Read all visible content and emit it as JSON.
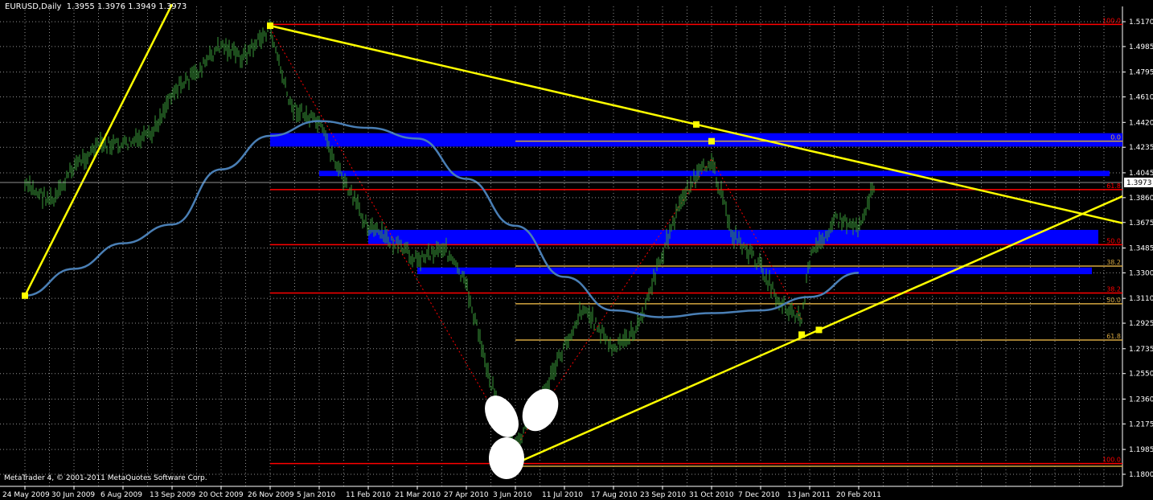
{
  "header": {
    "symbol": "EURUSD,Daily",
    "ohlc": "1.3955 1.3976 1.3949 1.3973"
  },
  "footer": {
    "copyright": "MetaTrader 4, © 2001-2011 MetaQuotes Software Corp."
  },
  "colors": {
    "background": "#000000",
    "grid": "#c0c0c0",
    "price_bars": "#3a9a3a",
    "moving_average": "#4a7fb5",
    "trendline": "#ffff00",
    "support_resistance": "#ff0000",
    "fib_gold": "#d4a640",
    "zone_blue": "#0000ff",
    "axis_text": "#ffffff",
    "current_price_bg": "#ffffff",
    "marker_fill": "#ffffff"
  },
  "chart_data": {
    "type": "candlestick",
    "title": "EURUSD,Daily",
    "ylim": [
      1.171,
      1.53
    ],
    "y_ticks": [
      "1.5170",
      "1.4985",
      "1.4795",
      "1.4610",
      "1.4420",
      "1.4235",
      "1.4045",
      "1.3860",
      "1.3675",
      "1.3485",
      "1.3300",
      "1.3110",
      "1.2925",
      "1.2735",
      "1.2550",
      "1.2360",
      "1.2175",
      "1.1985",
      "1.1800"
    ],
    "x_ticks": [
      "24 May 2009",
      "30 Jun 2009",
      "6 Aug 2009",
      "13 Sep 2009",
      "20 Oct 2009",
      "26 Nov 2009",
      "5 Jan 2010",
      "11 Feb 2010",
      "21 Mar 2010",
      "27 Apr 2010",
      "3 Jun 2010",
      "11 Jul 2010",
      "17 Aug 2010",
      "23 Sep 2010",
      "31 Oct 2010",
      "7 Dec 2010",
      "13 Jan 2011",
      "20 Feb 2011"
    ],
    "current_price": "1.3973",
    "price_path": [
      {
        "x": "24 May 2009",
        "y": 1.395
      },
      {
        "x": "15 Jun 2009",
        "y": 1.383
      },
      {
        "x": "30 Jun 2009",
        "y": 1.41
      },
      {
        "x": "20 Jul 2009",
        "y": 1.425
      },
      {
        "x": "6 Aug 2009",
        "y": 1.425
      },
      {
        "x": "28 Aug 2009",
        "y": 1.432
      },
      {
        "x": "13 Sep 2009",
        "y": 1.465
      },
      {
        "x": "1 Oct 2009",
        "y": 1.478
      },
      {
        "x": "20 Oct 2009",
        "y": 1.5
      },
      {
        "x": "5 Nov 2009",
        "y": 1.49
      },
      {
        "x": "26 Nov 2009",
        "y": 1.512
      },
      {
        "x": "12 Dec 2009",
        "y": 1.455
      },
      {
        "x": "5 Jan 2010",
        "y": 1.44
      },
      {
        "x": "25 Jan 2010",
        "y": 1.395
      },
      {
        "x": "11 Feb 2010",
        "y": 1.365
      },
      {
        "x": "5 Mar 2010",
        "y": 1.35
      },
      {
        "x": "21 Mar 2010",
        "y": 1.34
      },
      {
        "x": "10 Apr 2010",
        "y": 1.35
      },
      {
        "x": "27 Apr 2010",
        "y": 1.32
      },
      {
        "x": "15 May 2010",
        "y": 1.25
      },
      {
        "x": "3 Jun 2010",
        "y": 1.2
      },
      {
        "x": "20 Jun 2010",
        "y": 1.23
      },
      {
        "x": "11 Jul 2010",
        "y": 1.275
      },
      {
        "x": "25 Jul 2010",
        "y": 1.305
      },
      {
        "x": "5 Aug 2010",
        "y": 1.29
      },
      {
        "x": "17 Aug 2010",
        "y": 1.272
      },
      {
        "x": "5 Sep 2010",
        "y": 1.29
      },
      {
        "x": "23 Sep 2010",
        "y": 1.345
      },
      {
        "x": "10 Oct 2010",
        "y": 1.39
      },
      {
        "x": "31 Oct 2010",
        "y": 1.415
      },
      {
        "x": "15 Nov 2010",
        "y": 1.36
      },
      {
        "x": "7 Dec 2010",
        "y": 1.335
      },
      {
        "x": "20 Dec 2010",
        "y": 1.31
      },
      {
        "x": "7 Jan 2011",
        "y": 1.295
      },
      {
        "x": "13 Jan 2011",
        "y": 1.34
      },
      {
        "x": "1 Feb 2011",
        "y": 1.37
      },
      {
        "x": "20 Feb 2011",
        "y": 1.365
      },
      {
        "x": "5 Mar 2011",
        "y": 1.3973
      }
    ],
    "moving_average": [
      {
        "x": "24 May 2009",
        "y": 1.313
      },
      {
        "x": "30 Jun 2009",
        "y": 1.333
      },
      {
        "x": "6 Aug 2009",
        "y": 1.352
      },
      {
        "x": "13 Sep 2009",
        "y": 1.366
      },
      {
        "x": "20 Oct 2009",
        "y": 1.407
      },
      {
        "x": "26 Nov 2009",
        "y": 1.432
      },
      {
        "x": "5 Jan 2010",
        "y": 1.443
      },
      {
        "x": "11 Feb 2010",
        "y": 1.438
      },
      {
        "x": "21 Mar 2010",
        "y": 1.43
      },
      {
        "x": "27 Apr 2010",
        "y": 1.4
      },
      {
        "x": "3 Jun 2010",
        "y": 1.365
      },
      {
        "x": "11 Jul 2010",
        "y": 1.327
      },
      {
        "x": "17 Aug 2010",
        "y": 1.302
      },
      {
        "x": "23 Sep 2010",
        "y": 1.297
      },
      {
        "x": "31 Oct 2010",
        "y": 1.3
      },
      {
        "x": "7 Dec 2010",
        "y": 1.302
      },
      {
        "x": "13 Jan 2011",
        "y": 1.312
      },
      {
        "x": "20 Feb 2011",
        "y": 1.33
      }
    ],
    "trendlines": [
      {
        "color": "yellow",
        "points": [
          {
            "x": "24 May 2009",
            "y": 1.313
          },
          {
            "x": "13 Sep 2009",
            "y": 1.53
          }
        ]
      },
      {
        "color": "yellow",
        "points": [
          {
            "x": "26 Nov 2009",
            "y": 1.514
          },
          {
            "x": "right",
            "y": 1.367
          }
        ]
      },
      {
        "color": "yellow",
        "points": [
          {
            "x": "3 Jun 2010",
            "y": 1.188
          },
          {
            "x": "right",
            "y": 1.387
          }
        ]
      }
    ],
    "horizontal_levels": [
      {
        "price": 1.515,
        "color": "red",
        "label": "100.0"
      },
      {
        "price": 1.392,
        "color": "red",
        "label": "61.8"
      },
      {
        "price": 1.351,
        "color": "red",
        "label": "50.0"
      },
      {
        "price": 1.315,
        "color": "red",
        "label": "38.2"
      },
      {
        "price": 1.188,
        "color": "red",
        "label": "100.0"
      },
      {
        "price": 1.428,
        "color": "gold",
        "label": "0.0"
      },
      {
        "price": 1.335,
        "color": "gold",
        "label": "38.2"
      },
      {
        "price": 1.307,
        "color": "gold",
        "label": "50.0"
      },
      {
        "price": 1.28,
        "color": "gold",
        "label": "61.8"
      },
      {
        "price": 1.186,
        "color": "gold",
        "label": ""
      }
    ],
    "blue_zones": [
      {
        "from": "26 Nov 2009",
        "low": 1.424,
        "high": 1.434
      },
      {
        "from": "5 Jan 2010",
        "low": 1.402,
        "high": 1.406
      },
      {
        "from": "11 Feb 2010",
        "low": 1.3515,
        "high": 1.362
      },
      {
        "from": "21 Mar 2010",
        "low": 1.329,
        "high": 1.334
      }
    ],
    "grid": true
  }
}
